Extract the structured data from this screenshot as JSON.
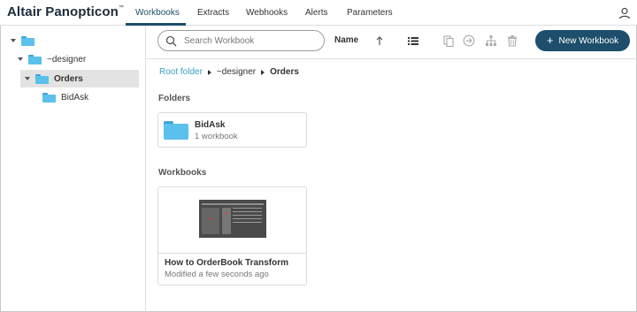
{
  "app": {
    "brand": "Altair Panopticon",
    "brand_mark": "™"
  },
  "nav": {
    "tabs": [
      {
        "label": "Workbooks",
        "active": true
      },
      {
        "label": "Extracts",
        "active": false
      },
      {
        "label": "Webhooks",
        "active": false
      },
      {
        "label": "Alerts",
        "active": false
      },
      {
        "label": "Parameters",
        "active": false
      }
    ],
    "user_icon": "user-icon"
  },
  "sidebar": {
    "tree": [
      {
        "label": "",
        "expanded": true,
        "level": 0
      },
      {
        "label": "~designer",
        "expanded": true,
        "level": 1
      },
      {
        "label": "Orders",
        "expanded": true,
        "level": 2,
        "selected": true
      },
      {
        "label": "BidAsk",
        "expanded": false,
        "level": 3
      }
    ]
  },
  "toolbar": {
    "search_placeholder": "Search Workbook",
    "sort_label": "Name",
    "icons": [
      "sort-ascending-icon",
      "list-view-icon",
      "copy-icon",
      "move-icon",
      "hierarchy-icon",
      "delete-icon"
    ],
    "new_button_label": "New Workbook"
  },
  "breadcrumb": {
    "root": "Root folder",
    "middle": "~designer",
    "current": "Orders"
  },
  "folders": {
    "title": "Folders",
    "items": [
      {
        "name": "BidAsk",
        "count": "1 workbook"
      }
    ]
  },
  "workbooks": {
    "title": "Workbooks",
    "items": [
      {
        "name": "How to OrderBook Transform",
        "modified": "Modified a few seconds ago"
      }
    ]
  },
  "colors": {
    "primary": "#1d4e6b",
    "link": "#3a9fc7",
    "folder": "#5bc0eb",
    "selected_row": "#e3e3e3"
  }
}
